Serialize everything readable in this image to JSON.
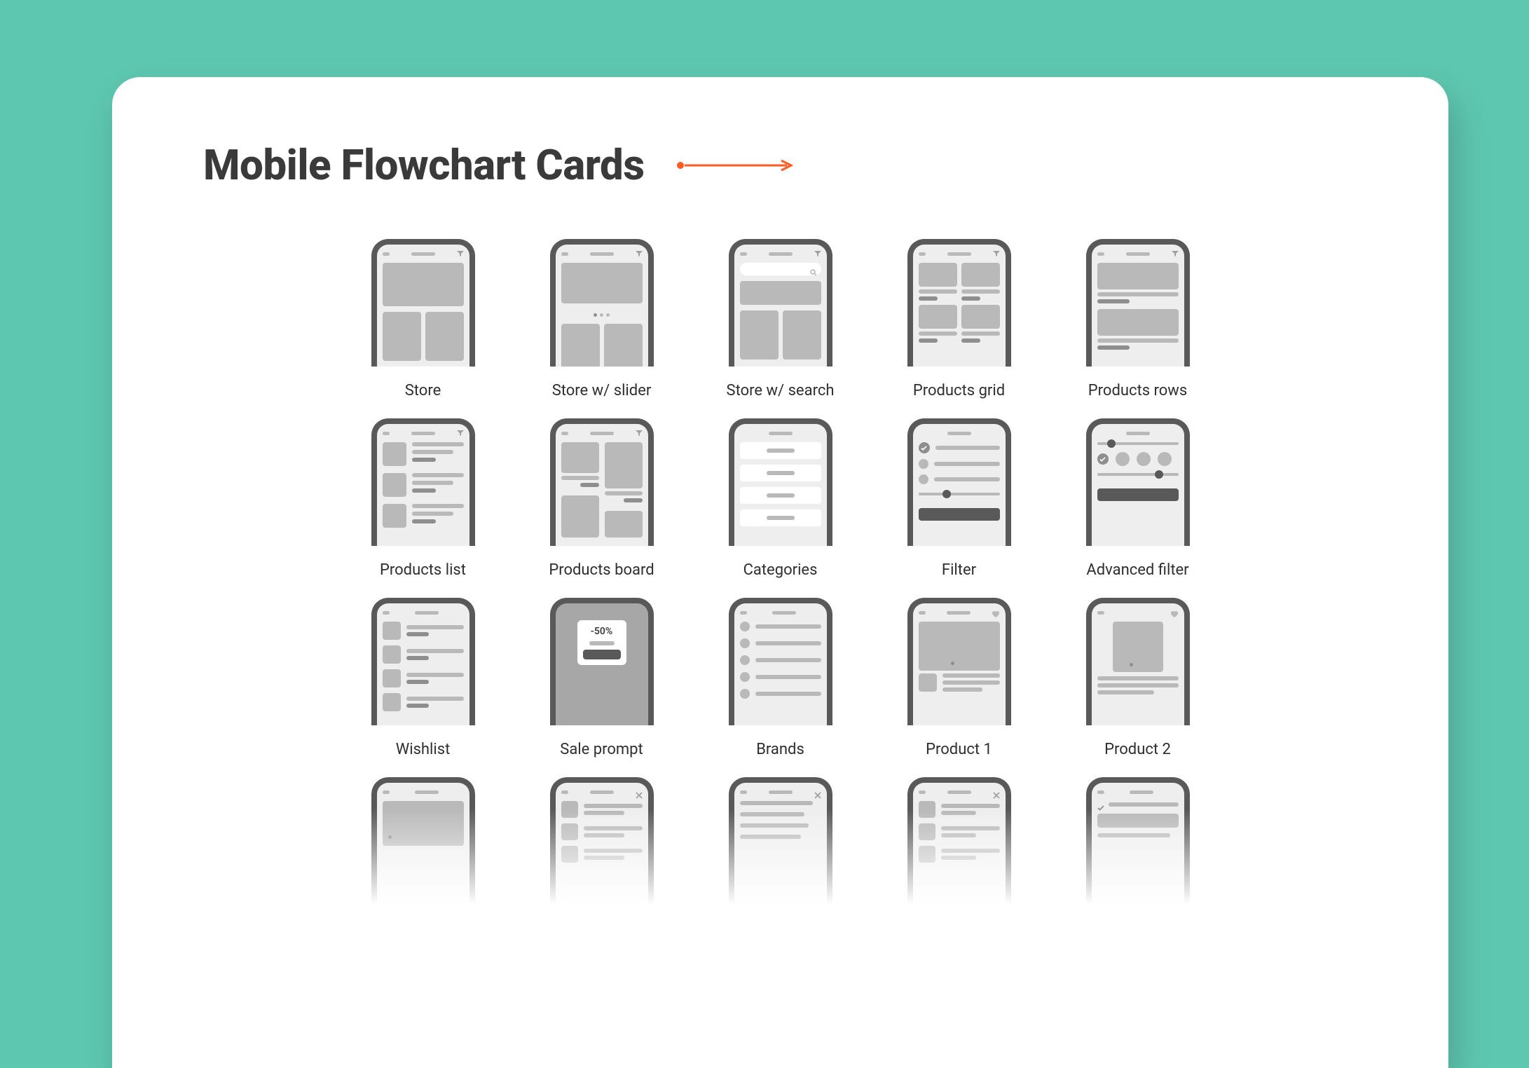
{
  "header": {
    "title": "Mobile Flowchart Cards"
  },
  "colors": {
    "accent": "#ff5a1f"
  },
  "sale": {
    "text": "-50%"
  },
  "cards": [
    {
      "id": "store",
      "label": "Store"
    },
    {
      "id": "store-slider",
      "label": "Store w/ slider"
    },
    {
      "id": "store-search",
      "label": "Store w/ search"
    },
    {
      "id": "products-grid",
      "label": "Products grid"
    },
    {
      "id": "products-rows",
      "label": "Products rows"
    },
    {
      "id": "products-list",
      "label": "Products list"
    },
    {
      "id": "products-board",
      "label": "Products board"
    },
    {
      "id": "categories",
      "label": "Categories"
    },
    {
      "id": "filter",
      "label": "Filter"
    },
    {
      "id": "advanced-filter",
      "label": "Advanced filter"
    },
    {
      "id": "wishlist",
      "label": "Wishlist"
    },
    {
      "id": "sale-prompt",
      "label": "Sale prompt"
    },
    {
      "id": "brands",
      "label": "Brands"
    },
    {
      "id": "product-1",
      "label": "Product 1"
    },
    {
      "id": "product-2",
      "label": "Product 2"
    },
    {
      "id": "faded-1",
      "label": ""
    },
    {
      "id": "faded-2",
      "label": ""
    },
    {
      "id": "faded-3",
      "label": ""
    },
    {
      "id": "faded-4",
      "label": ""
    },
    {
      "id": "faded-5",
      "label": ""
    }
  ]
}
